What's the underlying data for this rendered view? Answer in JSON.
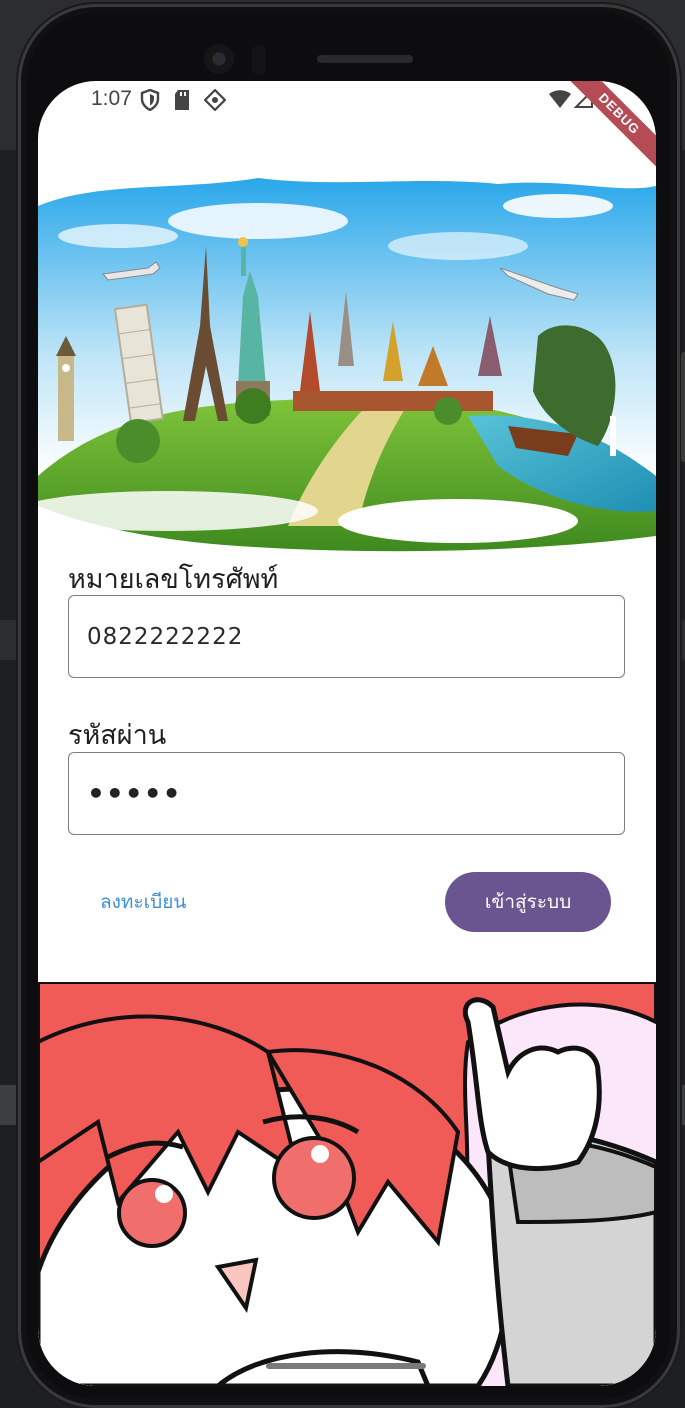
{
  "status_bar": {
    "time": "1:07",
    "debug_label": "DEBUG",
    "icons": [
      "shield-icon",
      "sd-card-icon",
      "gear-diamond-icon",
      "wifi-icon",
      "signal-icon",
      "battery-icon"
    ]
  },
  "form": {
    "phone_label": "หมายเลขโทรศัพท์",
    "phone_value": "0822222222",
    "password_label": "รหัสผ่าน",
    "password_masked": "•••••"
  },
  "actions": {
    "register_label": "ลงทะเบียน",
    "login_label": "เข้าสู่ระบบ"
  },
  "colors": {
    "login_button": "#6b5590",
    "register_link": "#3d8fd8",
    "debug_ribbon": "#b44b55",
    "mascot_hair": "#f05a57",
    "mascot_bg": "#fbe6fa"
  }
}
